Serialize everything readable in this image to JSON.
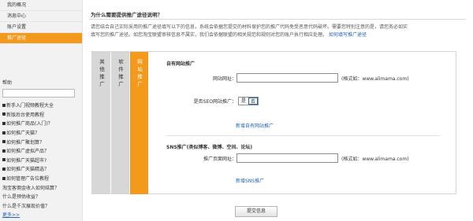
{
  "sidebar": {
    "menu": [
      {
        "label": "我的概况"
      },
      {
        "label": "消息中心"
      },
      {
        "label": "账户设置"
      },
      {
        "label": "推广途径"
      }
    ],
    "help_title": "帮助",
    "help_links": [
      {
        "label": "新手入门视频教程大全",
        "square": true
      },
      {
        "label": "新版后台使用教程",
        "square": true
      },
      {
        "label": "如何推广商品(入门)？",
        "square": true
      },
      {
        "label": "如何推广天猫？",
        "square": true
      },
      {
        "label": "如何推广聚划算？",
        "square": true
      },
      {
        "label": "如何推广虚拟产品？",
        "square": true
      },
      {
        "label": "如何推广天猫超市?",
        "square": true
      },
      {
        "label": "如何推广天猫精选？",
        "square": true
      },
      {
        "label": "如何管理广告位教程",
        "square": true
      },
      {
        "label": "淘宝客佣金收入如何结算？",
        "square": false
      },
      {
        "label": "什么是预估收益？",
        "square": false
      },
      {
        "label": "什么是千次展现价值？",
        "square": false
      }
    ],
    "more": "更多>>"
  },
  "main": {
    "question": "为什么需要提供推广途径说明？",
    "desc_lines": [
      "请您结合自己实际采用的推广途径填写以下的信息，系统会依据您提交的材料保护您的推广代码免受恶意代码破坏。需要您特别注意的是，请您务必如实",
      "填写您的推广途径。如您淘宝联盟审核信息不属实，我们会依据联盟的相关规范和规则对您的账户执行相应处理。"
    ],
    "desc_link": "如何填写推广途径",
    "tabs": [
      {
        "label": "其他推广"
      },
      {
        "label": "软件推广"
      },
      {
        "label": "网站推广"
      }
    ],
    "site_section": {
      "title": "自有网站推广",
      "url_label": "网站网址：",
      "url_value": "",
      "url_hint": "(格式如：www.alimama.com)",
      "seo_label": "是否SEO网站推广：",
      "seo_options": [
        "是",
        "否"
      ],
      "seo_selected": "否",
      "add_link": "新增自有网站推广"
    },
    "sns_section": {
      "title": "SNS推广(类似博客、微博、空间、论坛)",
      "url_label": "推广页面网址：",
      "url_value": "",
      "url_hint": "(格式如：www.alimama.com)",
      "add_link": "新增SNS推广"
    },
    "submit_label": "提交信息"
  },
  "colors": {
    "accent": "#f39a1c",
    "link": "#2463b3",
    "tab_inactive": "#d7d7d7"
  }
}
